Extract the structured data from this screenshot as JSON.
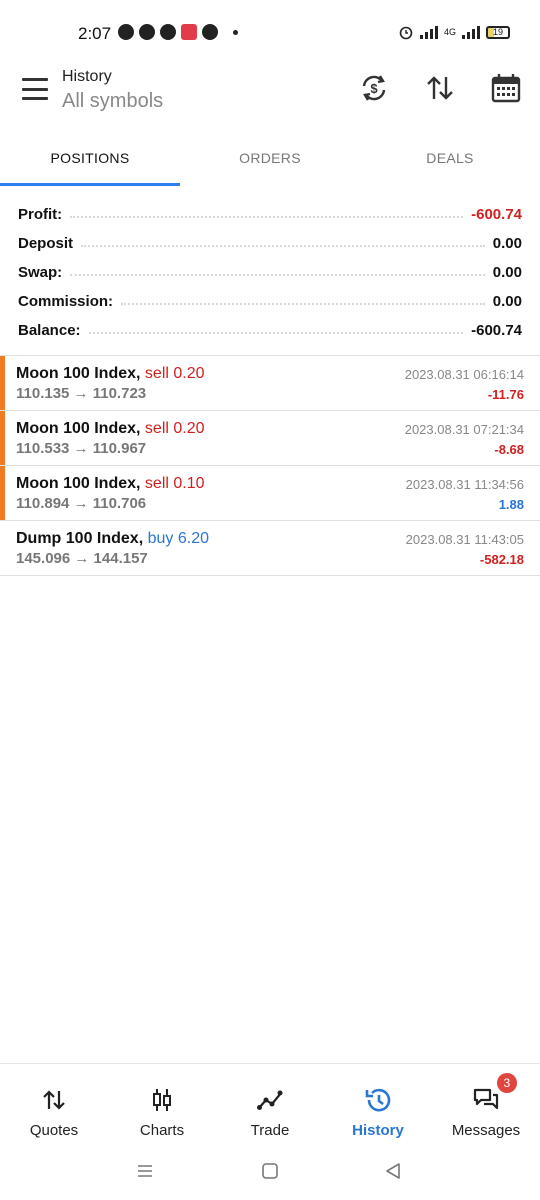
{
  "status": {
    "time": "2:07",
    "battery": "19",
    "network": "4G"
  },
  "header": {
    "title": "History",
    "subtitle": "All symbols"
  },
  "tabs": [
    {
      "label": "POSITIONS",
      "active": true
    },
    {
      "label": "ORDERS",
      "active": false
    },
    {
      "label": "DEALS",
      "active": false
    }
  ],
  "summary": [
    {
      "label": "Profit:",
      "value": "-600.74",
      "negative": true
    },
    {
      "label": "Deposit",
      "value": "0.00",
      "negative": false
    },
    {
      "label": "Swap:",
      "value": "0.00",
      "negative": false
    },
    {
      "label": "Commission:",
      "value": "0.00",
      "negative": false
    },
    {
      "label": "Balance:",
      "value": "-600.74",
      "negative": false
    }
  ],
  "positions": [
    {
      "symbol": "Moon 100 Index,",
      "side": "sell 0.20",
      "type": "sell",
      "prices": "110.135 → 110.723",
      "time": "2023.08.31 06:16:14",
      "pnl": "-11.76",
      "pnl_sign": "neg",
      "marker": true
    },
    {
      "symbol": "Moon 100 Index,",
      "side": "sell 0.20",
      "type": "sell",
      "prices": "110.533 → 110.967",
      "time": "2023.08.31 07:21:34",
      "pnl": "-8.68",
      "pnl_sign": "neg",
      "marker": true
    },
    {
      "symbol": "Moon 100 Index,",
      "side": "sell 0.10",
      "type": "sell",
      "prices": "110.894 → 110.706",
      "time": "2023.08.31 11:34:56",
      "pnl": "1.88",
      "pnl_sign": "pos",
      "marker": true
    },
    {
      "symbol": "Dump 100 Index,",
      "side": "buy 6.20",
      "type": "buy",
      "prices": "145.096 → 144.157",
      "time": "2023.08.31 11:43:05",
      "pnl": "-582.18",
      "pnl_sign": "neg",
      "marker": false
    }
  ],
  "bottom_nav": [
    {
      "label": "Quotes",
      "icon": "quotes-icon",
      "active": false
    },
    {
      "label": "Charts",
      "icon": "charts-icon",
      "active": false
    },
    {
      "label": "Trade",
      "icon": "trade-icon",
      "active": false
    },
    {
      "label": "History",
      "icon": "history-icon",
      "active": true
    },
    {
      "label": "Messages",
      "icon": "messages-icon",
      "active": false,
      "badge": "3"
    }
  ],
  "colors": {
    "accent": "#2a76d2",
    "negative": "#d21f1f",
    "marker": "#f07b22"
  }
}
